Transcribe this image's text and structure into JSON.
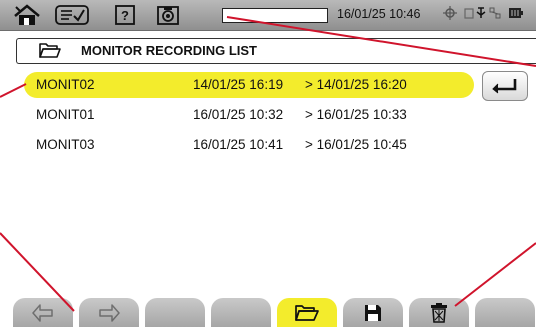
{
  "topbar": {
    "datetime": "16/01/25 10:46"
  },
  "header": {
    "title": "MONITOR RECORDING LIST"
  },
  "recordings": [
    {
      "name": "MONIT02",
      "start": "14/01/25 16:19",
      "end": ">  14/01/25 16:20",
      "selected": true
    },
    {
      "name": "MONIT01",
      "start": "16/01/25 10:32",
      "end": ">  16/01/25 10:33",
      "selected": false
    },
    {
      "name": "MONIT03",
      "start": "16/01/25 10:41",
      "end": ">  16/01/25 10:45",
      "selected": false
    }
  ],
  "icons": {
    "home": "home-icon",
    "checklist": "checklist-icon",
    "help": "help-icon",
    "camera": "camera-icon",
    "enter": "enter-icon",
    "open": "folder-icon",
    "save": "save-icon",
    "delete": "trash-icon"
  },
  "colors": {
    "selection": "#f3ec2c",
    "callout": "#d0142c"
  }
}
